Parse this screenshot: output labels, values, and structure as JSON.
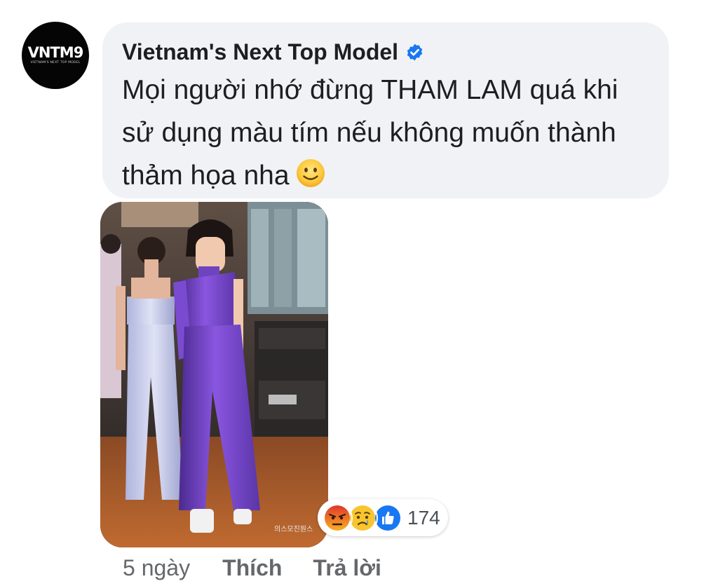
{
  "avatar": {
    "logo_text": "VNTM9",
    "logo_sub": "VIETNAM'S NEXT TOP MODEL"
  },
  "comment": {
    "author": "Vietnam's Next Top Model",
    "verified_icon": "verified-checkmark-icon",
    "text": "Mọi người nhớ đừng THAM LAM quá khi sử dụng màu tím nếu không muốn thành thảm họa nha",
    "emoji": "slightly-smiling-face-emoji"
  },
  "attachment": {
    "type": "photo",
    "watermark": "의스모진원스"
  },
  "reactions": {
    "icons": [
      "angry-reaction-icon",
      "sad-reaction-icon",
      "like-reaction-icon"
    ],
    "count": "174"
  },
  "meta": {
    "time": "5 ngày",
    "like_label": "Thích",
    "reply_label": "Trả lời"
  },
  "colors": {
    "bubble_bg": "#f0f2f5",
    "text": "#1c1e21",
    "meta_text": "#65676b",
    "verified_blue": "#1877f2",
    "like_blue": "#1877f2",
    "angry_orange": "#e9710f",
    "sad_yellow": "#f7b125"
  }
}
